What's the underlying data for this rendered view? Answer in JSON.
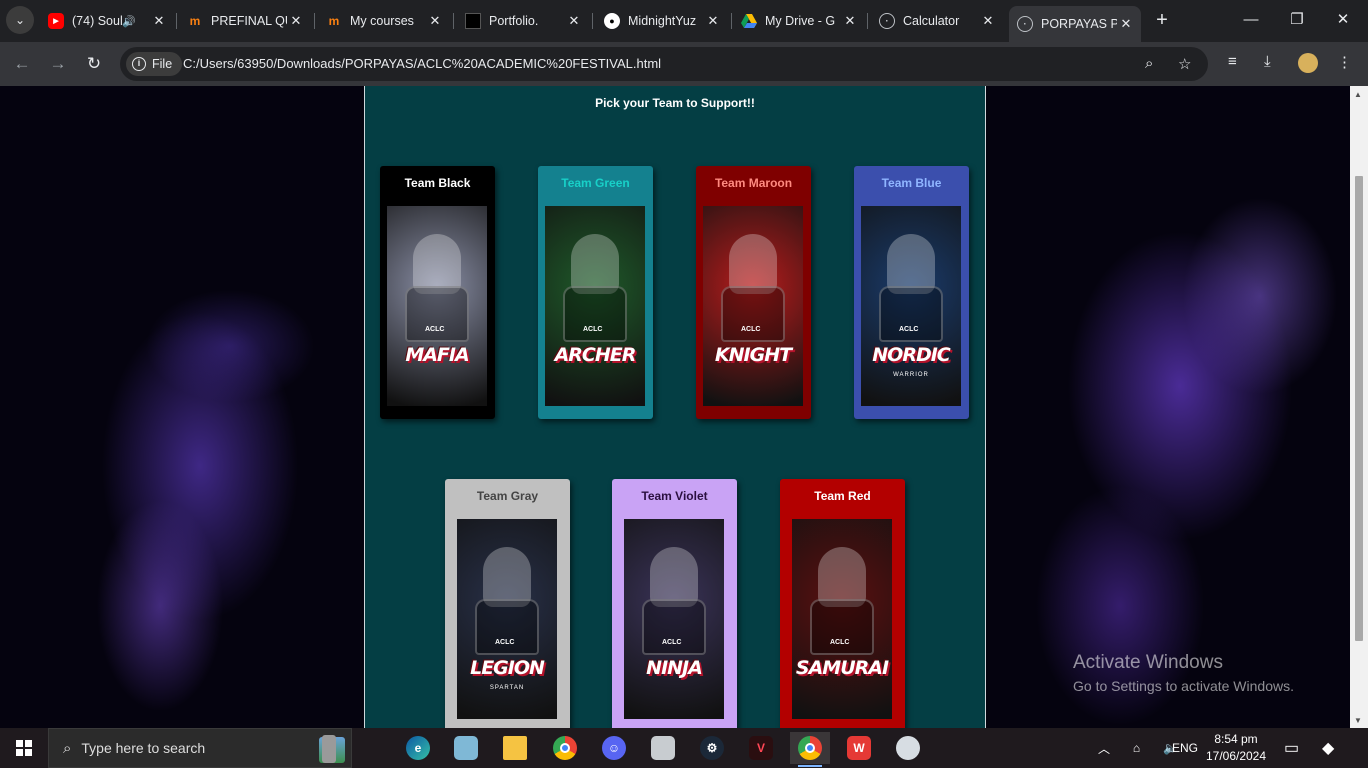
{
  "browser": {
    "tabs": [
      {
        "title": "(74) Soul",
        "icon": "youtube-icon",
        "audio": true
      },
      {
        "title": "PREFINAL QU",
        "icon": "moodle-icon"
      },
      {
        "title": "My courses",
        "icon": "moodle-icon"
      },
      {
        "title": "Portfolio.",
        "icon": "portfolio-icon"
      },
      {
        "title": "MidnightYuz",
        "icon": "github-icon"
      },
      {
        "title": "My Drive - G",
        "icon": "google-drive-icon"
      },
      {
        "title": "Calculator",
        "icon": "globe-icon"
      },
      {
        "title": "PORPAYAS P",
        "icon": "globe-icon",
        "active": true
      }
    ],
    "file_chip": "File",
    "url": "C:/Users/63950/Downloads/PORPAYAS/ACLC%20ACADEMIC%20FESTIVAL.html"
  },
  "page": {
    "heading": "Pick your Team to Support!!",
    "teams": [
      {
        "name": "Team Black",
        "mascot": "MAFIA",
        "card_color": "#000000",
        "text_color": "#ffffff",
        "art_color": "#8a8fa6"
      },
      {
        "name": "Team Green",
        "mascot": "ARCHER",
        "card_color": "#14818f",
        "text_color": "#18d0c8",
        "art_color": "#1f5a2a"
      },
      {
        "name": "Team Maroon",
        "mascot": "KNIGHT",
        "card_color": "#7f0000",
        "text_color": "#ff8a80",
        "art_color": "#b71c1c"
      },
      {
        "name": "Team Blue",
        "mascot": "NORDIC",
        "card_color": "#3b4fad",
        "text_color": "#8fb5ff",
        "art_color": "#1a3b6b"
      },
      {
        "name": "Team Gray",
        "mascot": "LEGION",
        "card_color": "#c0c0c0",
        "text_color": "#444444",
        "art_color": "#283048"
      },
      {
        "name": "Team Violet",
        "mascot": "NINJA",
        "card_color": "#c9a3f5",
        "text_color": "#2b1040",
        "art_color": "#3a3358"
      },
      {
        "name": "Team Red",
        "mascot": "SAMURAI",
        "card_color": "#b30000",
        "text_color": "#ffffff",
        "art_color": "#5a1010"
      }
    ],
    "mascot_subtitles": {
      "NORDIC": "WARRIOR",
      "LEGION": "SPARTAN"
    },
    "aclc": "ACLC"
  },
  "watermark": {
    "title": "Activate Windows",
    "subtitle": "Go to Settings to activate Windows."
  },
  "taskbar": {
    "search_placeholder": "Type here to search",
    "language": "ENG",
    "time": "8:54 pm",
    "date": "17/06/2024"
  }
}
